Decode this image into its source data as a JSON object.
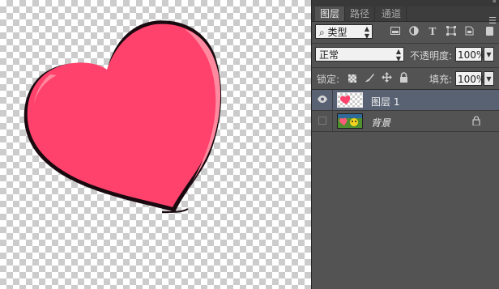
{
  "panel": {
    "tabs": [
      {
        "label": "图层",
        "active": true
      },
      {
        "label": "路径",
        "active": false
      },
      {
        "label": "通道",
        "active": false
      }
    ],
    "collapse_glyph": "«",
    "menu_glyph": "☰"
  },
  "filter": {
    "kind_label": "⌕ 类型",
    "icons": [
      "image-filter-icon",
      "adjustment-filter-icon",
      "type-filter-icon",
      "shape-filter-icon",
      "smart-object-filter-icon"
    ]
  },
  "blend": {
    "mode": "正常",
    "opacity_label": "不透明度:",
    "opacity_value": "100%"
  },
  "lock": {
    "label": "锁定:",
    "fill_label": "填充:",
    "fill_value": "100%"
  },
  "layers": [
    {
      "name": "图层 1",
      "visible": true,
      "selected": true
    },
    {
      "name": "背景",
      "visible": false,
      "selected": false,
      "locked": true
    }
  ],
  "colors": {
    "heart_fill": "#ff426c",
    "heart_highlight": "#ff7a92",
    "selection": "#596273",
    "panel_bg": "#535353"
  }
}
